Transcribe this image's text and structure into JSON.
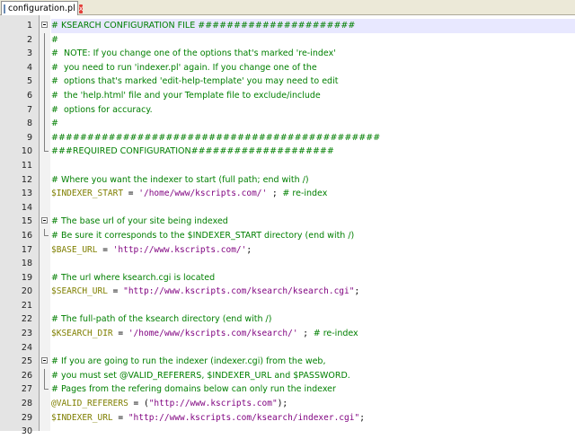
{
  "tab": {
    "title": "configuration.pl",
    "close": "x",
    "file_icon": "perl-file-icon",
    "close_icon": "close-icon"
  },
  "colors": {
    "comment": "#007f00",
    "variable": "#7f7f00",
    "string": "#7f007f",
    "current_line": "#e8e8ff"
  },
  "lines": [
    {
      "num": "1",
      "fold": "start",
      "current": true,
      "parts": [
        [
          "comment",
          "# KSEARCH CONFIGURATION FILE ######################"
        ]
      ]
    },
    {
      "num": "2",
      "fold": "bar",
      "parts": [
        [
          "comment",
          "#"
        ]
      ]
    },
    {
      "num": "3",
      "fold": "bar",
      "parts": [
        [
          "comment",
          "#  NOTE: If you change one of the options that's marked 're-index'"
        ]
      ]
    },
    {
      "num": "4",
      "fold": "bar",
      "parts": [
        [
          "comment",
          "#  you need to run 'indexer.pl' again. If you change one of the"
        ]
      ]
    },
    {
      "num": "5",
      "fold": "bar",
      "parts": [
        [
          "comment",
          "#  options that's marked 'edit-help-template' you may need to edit"
        ]
      ]
    },
    {
      "num": "6",
      "fold": "bar",
      "parts": [
        [
          "comment",
          "#  the 'help.html' file and your Template file to exclude/include"
        ]
      ]
    },
    {
      "num": "7",
      "fold": "bar",
      "parts": [
        [
          "comment",
          "#  options for accuracy."
        ]
      ]
    },
    {
      "num": "8",
      "fold": "bar",
      "parts": [
        [
          "comment",
          "#"
        ]
      ]
    },
    {
      "num": "9",
      "fold": "bar",
      "parts": [
        [
          "comment",
          "##############################################"
        ]
      ]
    },
    {
      "num": "10",
      "fold": "end",
      "parts": [
        [
          "comment",
          "###REQUIRED CONFIGURATION####################"
        ]
      ]
    },
    {
      "num": "11",
      "fold": "",
      "parts": []
    },
    {
      "num": "12",
      "fold": "",
      "parts": [
        [
          "comment",
          "# Where you want the indexer to start (full path; end with /)"
        ]
      ]
    },
    {
      "num": "13",
      "fold": "",
      "parts": [
        [
          "var",
          "$INDEXER_START"
        ],
        [
          "op",
          " = "
        ],
        [
          "str",
          "'/home/www/kscripts.com/'"
        ],
        [
          "op",
          " ; "
        ],
        [
          "comment",
          "# re-index"
        ]
      ]
    },
    {
      "num": "14",
      "fold": "",
      "parts": []
    },
    {
      "num": "15",
      "fold": "start",
      "parts": [
        [
          "comment",
          "# The base url of your site being indexed"
        ]
      ]
    },
    {
      "num": "16",
      "fold": "end",
      "parts": [
        [
          "comment",
          "# Be sure it corresponds to the $INDEXER_START directory (end with /)"
        ]
      ]
    },
    {
      "num": "17",
      "fold": "",
      "parts": [
        [
          "var",
          "$BASE_URL"
        ],
        [
          "op",
          " = "
        ],
        [
          "str",
          "'http://www.kscripts.com/'"
        ],
        [
          "op",
          ";"
        ]
      ]
    },
    {
      "num": "18",
      "fold": "",
      "parts": []
    },
    {
      "num": "19",
      "fold": "",
      "parts": [
        [
          "comment",
          "# The url where ksearch.cgi is located"
        ]
      ]
    },
    {
      "num": "20",
      "fold": "",
      "parts": [
        [
          "var",
          "$SEARCH_URL"
        ],
        [
          "op",
          " = "
        ],
        [
          "str",
          "\"http://www.kscripts.com/ksearch/ksearch.cgi\""
        ],
        [
          "op",
          ";"
        ]
      ]
    },
    {
      "num": "21",
      "fold": "",
      "parts": []
    },
    {
      "num": "22",
      "fold": "",
      "parts": [
        [
          "comment",
          "# The full-path of the ksearch directory (end with /)"
        ]
      ]
    },
    {
      "num": "23",
      "fold": "",
      "parts": [
        [
          "var",
          "$KSEARCH_DIR"
        ],
        [
          "op",
          " = "
        ],
        [
          "str",
          "'/home/www/kscripts.com/ksearch/'"
        ],
        [
          "op",
          " ; "
        ],
        [
          "comment",
          "# re-index"
        ]
      ]
    },
    {
      "num": "24",
      "fold": "",
      "parts": []
    },
    {
      "num": "25",
      "fold": "start",
      "parts": [
        [
          "comment",
          "# If you are going to run the indexer (indexer.cgi) from the web,"
        ]
      ]
    },
    {
      "num": "26",
      "fold": "bar",
      "parts": [
        [
          "comment",
          "# you must set @VALID_REFERERS, $INDEXER_URL and $PASSWORD."
        ]
      ]
    },
    {
      "num": "27",
      "fold": "end",
      "parts": [
        [
          "comment",
          "# Pages from the refering domains below can only run the indexer"
        ]
      ]
    },
    {
      "num": "28",
      "fold": "",
      "parts": [
        [
          "var",
          "@VALID_REFERERS"
        ],
        [
          "op",
          " = ("
        ],
        [
          "str",
          "\"http://www.kscripts.com\""
        ],
        [
          "op",
          ");"
        ]
      ]
    },
    {
      "num": "29",
      "fold": "",
      "parts": [
        [
          "var",
          "$INDEXER_URL"
        ],
        [
          "op",
          " = "
        ],
        [
          "str",
          "\"http://www.kscripts.com/ksearch/indexer.cgi\""
        ],
        [
          "op",
          ";"
        ]
      ]
    },
    {
      "num": "30",
      "fold": "",
      "parts": []
    }
  ]
}
